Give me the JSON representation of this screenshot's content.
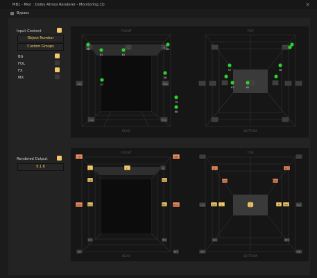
{
  "window": {
    "title": "MB1 - Mon : Dolby Atmos Renderer - Monitoring (1)",
    "close_label": "×"
  },
  "bypass": {
    "label": "Bypass"
  },
  "input_content": {
    "title": "Input Content",
    "object_number_label": "Object Number",
    "custom_groups_label": "Custom Groups",
    "groups": [
      {
        "label": "BG",
        "on": true
      },
      {
        "label": "FOL",
        "on": false
      },
      {
        "label": "FX",
        "on": true
      },
      {
        "label": "MX",
        "on": false
      }
    ]
  },
  "rendered_output": {
    "title": "Rendered Output",
    "format": "9.1.6"
  },
  "views": {
    "front": "FRONT",
    "top": "TOP",
    "rear": "REAR",
    "bottom": "BOTTOM"
  },
  "input_objects": {
    "front": [
      "58",
      "61",
      "62",
      "64",
      "57",
      "56",
      "70",
      "68"
    ],
    "top": [
      "57",
      "58",
      "61",
      "62"
    ]
  },
  "speakers": {
    "center": "C",
    "left": "L",
    "right": "R",
    "front_left_wide": "Lw",
    "front_right_wide": "Rw",
    "left_surround": "Lss",
    "right_surround": "Rss",
    "left_rear": "Lrs",
    "right_rear": "Rrs",
    "left_top_front": "Ltf",
    "right_top_front": "Rtf",
    "left_top_middle": "Ltm",
    "right_top_middle": "Rtm",
    "left_top_rear": "Ltr",
    "right_top_rear": "Rtr",
    "lfe": "LFE"
  },
  "colors": {
    "accent": "#f2c86b",
    "object_dot": "#2bd22b",
    "speaker_active": "#e8895a"
  }
}
